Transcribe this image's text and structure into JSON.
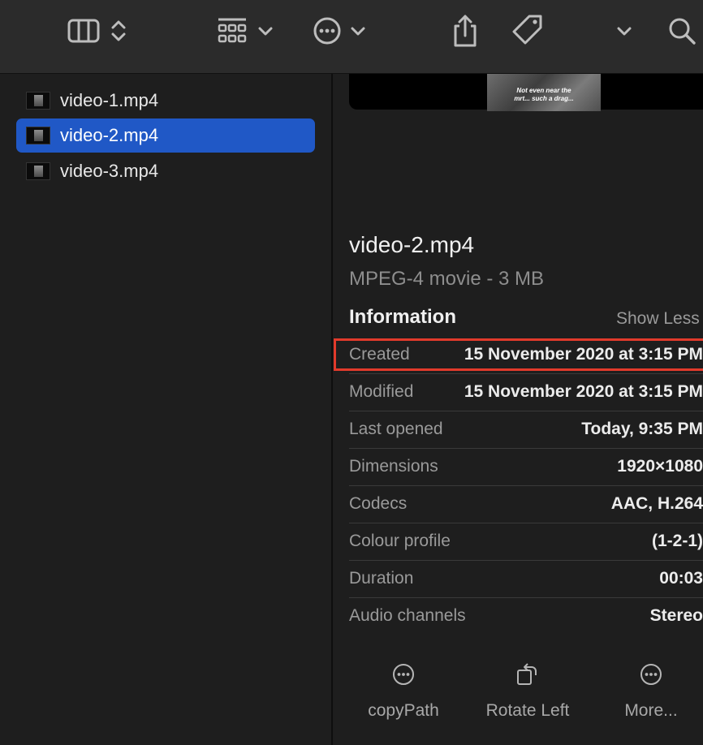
{
  "toolbar": {
    "icons": [
      "columns-view-icon",
      "sort-chevrons-icon",
      "group-grid-icon",
      "chevron-down-icon",
      "more-circle-icon",
      "chevron-down-icon",
      "share-icon",
      "tag-icon",
      "chevron-down-icon",
      "search-icon"
    ]
  },
  "files": [
    {
      "name": "video-1.mp4",
      "selected": false
    },
    {
      "name": "video-2.mp4",
      "selected": true
    },
    {
      "name": "video-3.mp4",
      "selected": false
    }
  ],
  "preview": {
    "caption": "Not even near the\nmrt... such a drag..."
  },
  "details": {
    "title": "video-2.mp4",
    "subtitle": "MPEG-4 movie - 3 MB",
    "section": "Information",
    "toggle": "Show Less",
    "rows": [
      {
        "key": "Created",
        "value": "15 November 2020 at 3:15 PM"
      },
      {
        "key": "Modified",
        "value": "15 November 2020 at 3:15 PM"
      },
      {
        "key": "Last opened",
        "value": "Today, 9:35 PM"
      },
      {
        "key": "Dimensions",
        "value": "1920×1080"
      },
      {
        "key": "Codecs",
        "value": "AAC, H.264"
      },
      {
        "key": "Colour profile",
        "value": "(1-2-1)"
      },
      {
        "key": "Duration",
        "value": "00:03"
      },
      {
        "key": "Audio channels",
        "value": "Stereo"
      }
    ]
  },
  "actions": [
    {
      "label": "copyPath",
      "icon": "more-circle-icon"
    },
    {
      "label": "Rotate Left",
      "icon": "rotate-left-icon"
    },
    {
      "label": "More...",
      "icon": "more-circle-icon"
    }
  ],
  "colors": {
    "selection": "#2058c6",
    "highlight": "#e23a2b",
    "background": "#1e1e1e",
    "toolbar": "#2b2b2b"
  }
}
